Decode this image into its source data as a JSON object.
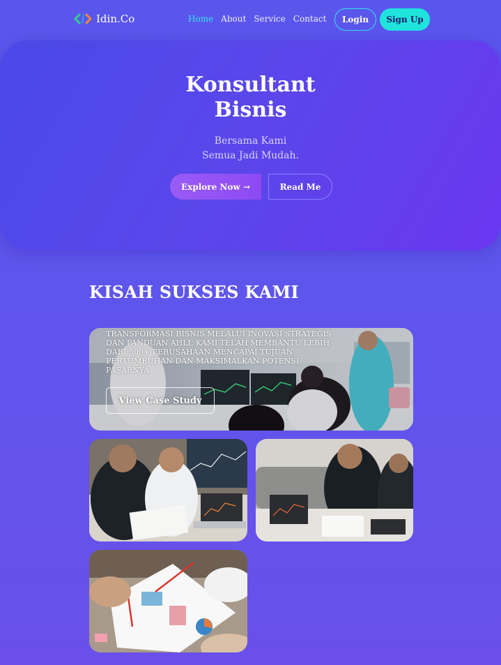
{
  "brand": {
    "name": "Idin.Co",
    "icon": "code-brackets-icon"
  },
  "nav": {
    "items": [
      {
        "label": "Home",
        "active": true
      },
      {
        "label": "About",
        "active": false
      },
      {
        "label": "Service",
        "active": false
      },
      {
        "label": "Contact",
        "active": false
      }
    ],
    "login_label": "Login",
    "signup_label": "Sign Up"
  },
  "hero": {
    "title_line1": "Konsultant",
    "title_line2": "Bisnis",
    "sub_line1": "Bersama Kami",
    "sub_line2": "Semua Jadi Mudah.",
    "explore_label": "Explore Now →",
    "readme_label": "Read Me"
  },
  "stories": {
    "title": "KISAH SUKSES KAMI",
    "featured_text": "Transformasi Bisnis Melalui Inovasi Strategis dan Panduan Ahli. Kami telah membantu lebih dari 500+ perusahaan mencapai tujuan pertumbuhan dan maksimalkan potensi pasarnya",
    "case_study_label": "View Case Study"
  },
  "colors": {
    "accent": "#35e3ee",
    "signup_bg": "#1fe4dc",
    "explore_bg": "#9a5cf6",
    "page_bg": "#5a56ec"
  }
}
